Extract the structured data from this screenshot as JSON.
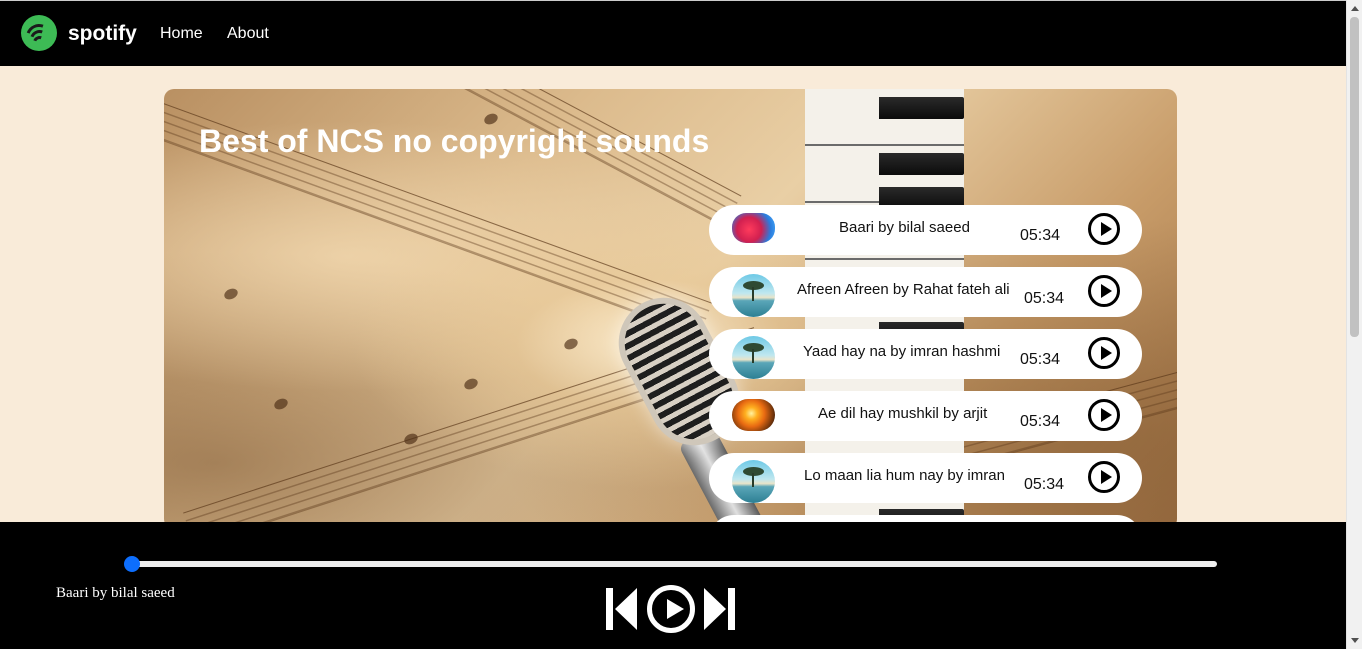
{
  "navbar": {
    "brand": "spotify",
    "logo_icon": "spotify-logo-icon",
    "links": [
      "Home",
      "About"
    ]
  },
  "hero": {
    "title": "Best of NCS no copyright sounds",
    "background_icon": "vintage-music-microphone-piano-image"
  },
  "songs": [
    {
      "name": "Baari by bilal saeed",
      "duration": "05:34",
      "cover": "red-cover-image",
      "play_icon": "play-circle-icon"
    },
    {
      "name": "Afreen Afreen by Rahat fateh ali",
      "duration": "05:34",
      "cover": "tree-cover-image",
      "play_icon": "play-circle-icon"
    },
    {
      "name": "Yaad hay na by imran hashmi",
      "duration": "05:34",
      "cover": "tree-cover-image",
      "play_icon": "play-circle-icon"
    },
    {
      "name": "Ae dil hay mushkil by arjit",
      "duration": "05:34",
      "cover": "sunset-cover-image",
      "play_icon": "play-circle-icon"
    },
    {
      "name": "Lo maan lia hum nay by imran",
      "duration": "05:34",
      "cover": "tree-cover-image",
      "play_icon": "play-circle-icon"
    }
  ],
  "player": {
    "now_playing": "Baari by bilal saeed",
    "progress": 0,
    "controls": [
      "previous-icon",
      "play-icon",
      "next-icon"
    ]
  },
  "colors": {
    "page_background": "#f9ebd9",
    "navbar": "#000000",
    "accent": "#0d6efd",
    "logo": "#3dbb55"
  }
}
